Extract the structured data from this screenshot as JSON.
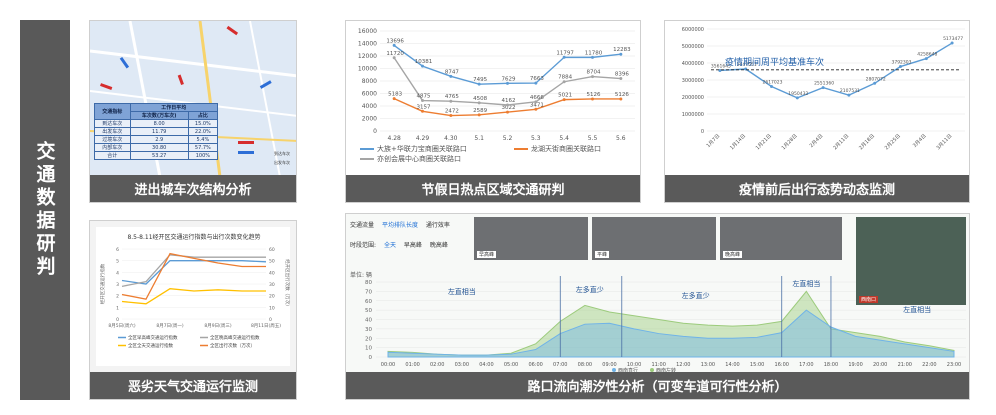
{
  "side_title": "交通数据研判",
  "panels": {
    "p1": {
      "caption": "进出城车次结构分析",
      "table": {
        "header": [
          "交通指标",
          "工作日平均"
        ],
        "subheader": [
          "",
          "车次数(万车次)",
          "占比"
        ],
        "rows": [
          [
            "到达车次",
            "8.00",
            "15.0%"
          ],
          [
            "出发车次",
            "11.79",
            "22.0%"
          ],
          [
            "过境车次",
            "2.9",
            "5.4%"
          ],
          [
            "内部车次",
            "30.80",
            "57.7%"
          ],
          [
            "合计",
            "53.27",
            "100%"
          ]
        ]
      },
      "legend": [
        "到达车次",
        "出发车次"
      ]
    },
    "p2": {
      "caption": "节假日热点区域交通研判",
      "chart_data": {
        "type": "line",
        "categories": [
          "4.28",
          "4.29",
          "4.30",
          "5.1",
          "5.2",
          "5.3",
          "5.4",
          "5.5",
          "5.6"
        ],
        "ylim": [
          0,
          16000
        ],
        "yticks": [
          "0",
          "2000",
          "4000",
          "6000",
          "8000",
          "10000",
          "12000",
          "14000",
          "16000"
        ],
        "series": [
          {
            "name": "大族+华联力宝商圈关联路口",
            "color": "#5b9bd5",
            "values": [
              13696,
              10381,
              8747,
              7495,
              7629,
              7663,
              11797,
              11780,
              12283
            ]
          },
          {
            "name": "龙湖天街商圈关联路口",
            "color": "#ed7d31",
            "values": [
              5183,
              3157,
              2472,
              2589,
              3022,
              3471,
              5021,
              5126,
              5126
            ]
          },
          {
            "name": "亦创会展中心商圈关联路口",
            "color": "#a5a5a5",
            "values": [
              11720,
              4875,
              4765,
              4508,
              4162,
              4666,
              7884,
              8704,
              8396
            ]
          }
        ]
      }
    },
    "p3": {
      "caption": "疫情前后出行态势动态监测",
      "chart_data": {
        "type": "line",
        "categories": [
          "1月7日",
          "1月14日",
          "1月21日",
          "1月28日",
          "2月4日",
          "2月11日",
          "2月18日",
          "2月25日",
          "3月4日",
          "3月11日",
          "3月18日"
        ],
        "ylim": [
          0,
          6000000
        ],
        "yticks": [
          "0",
          "1000000",
          "2000000",
          "3000000",
          "4000000",
          "5000000",
          "6000000"
        ],
        "series": [
          {
            "name": "",
            "color": "#5b9bd5",
            "values": [
              3561645,
              3647551,
              2617023,
              1950432,
              2551360,
              2107531,
              2807072,
              3792303,
              4258648,
              5173477
            ]
          }
        ],
        "annotation": "疫情期间周平均基准车次",
        "reference": 3600000
      }
    },
    "p4": {
      "caption": "恶劣天气交通运行监测",
      "chart_data": {
        "type": "line",
        "title": "8.5-8.11经开区交通运行指数与出行次数变化趋势",
        "ylabel_left": "经开区交通运行指数",
        "ylabel_right": "经开区出行次数（万次）",
        "categories": [
          "8月5日(周六)",
          "8月7日(周一)",
          "8月9日(周三)",
          "8月11日(周五)"
        ],
        "left_ticks": [
          "0",
          "1",
          "2",
          "3",
          "4",
          "5",
          "6"
        ],
        "right_ticks": [
          "0",
          "10",
          "20",
          "30",
          "40",
          "50",
          "60"
        ],
        "series": [
          {
            "name": "全区早高峰交通运行指数",
            "color": "#5b9bd5",
            "values": [
              3.3,
              3.0,
              5.0,
              5.0,
              5.0,
              5.0,
              4.9
            ]
          },
          {
            "name": "全区晚高峰交通运行指数",
            "color": "#a5a5a5",
            "values": [
              2.8,
              3.2,
              5.5,
              5.3,
              5.3,
              5.3,
              5.3
            ]
          },
          {
            "name": "全区全天交通运行指数",
            "color": "#ffc000",
            "values": [
              1.5,
              1.3,
              2.6,
              2.4,
              2.5,
              2.4,
              2.4
            ]
          },
          {
            "name": "全区出行次数（万次）",
            "color": "#ed7d31",
            "values": [
              2.1,
              1.7,
              5.6,
              5.2,
              4.8,
              4.5,
              4.5
            ]
          }
        ]
      }
    },
    "p5": {
      "caption": "路口流向潮汐性分析（可变车道可行性分析）",
      "tabs": [
        "交通流量",
        "平均排队长度",
        "通行效率"
      ],
      "filters": [
        "时段范围:",
        "全天",
        "早高峰",
        "晚高峰"
      ],
      "photo_labels": [
        "早高峰",
        "平峰",
        "晚高峰",
        "西南口"
      ],
      "unit_label": "单位: 辆",
      "annotations": [
        "左直相当",
        "左多直少",
        "左多直少",
        "左直相当",
        "左直相当"
      ],
      "legend": [
        "西南直行",
        "西南左转"
      ],
      "chart_data": {
        "type": "area",
        "categories": [
          "00:00",
          "01:00",
          "02:00",
          "03:00",
          "04:00",
          "05:00",
          "06:00",
          "07:00",
          "08:00",
          "09:00",
          "10:00",
          "11:00",
          "12:00",
          "13:00",
          "14:00",
          "15:00",
          "16:00",
          "17:00",
          "18:00",
          "19:00",
          "20:00",
          "21:00",
          "22:00",
          "23:00"
        ],
        "ylim": [
          0,
          80
        ],
        "yticks": [
          "0",
          "10",
          "20",
          "30",
          "40",
          "50",
          "60",
          "70",
          "80"
        ],
        "series": [
          {
            "name": "西南直行",
            "color": "#6fb3e8",
            "values": [
              5,
              4,
              3,
              2,
              2,
              3,
              8,
              25,
              35,
              36,
              30,
              25,
              22,
              20,
              20,
              21,
              26,
              50,
              32,
              22,
              18,
              14,
              10,
              6
            ]
          },
          {
            "name": "西南左转",
            "color": "#9ccb7c",
            "values": [
              6,
              5,
              3,
              2,
              2,
              4,
              14,
              38,
              55,
              48,
              44,
              40,
              36,
              34,
              33,
              34,
              38,
              70,
              30,
              26,
              22,
              16,
              12,
              7
            ]
          }
        ]
      }
    }
  }
}
